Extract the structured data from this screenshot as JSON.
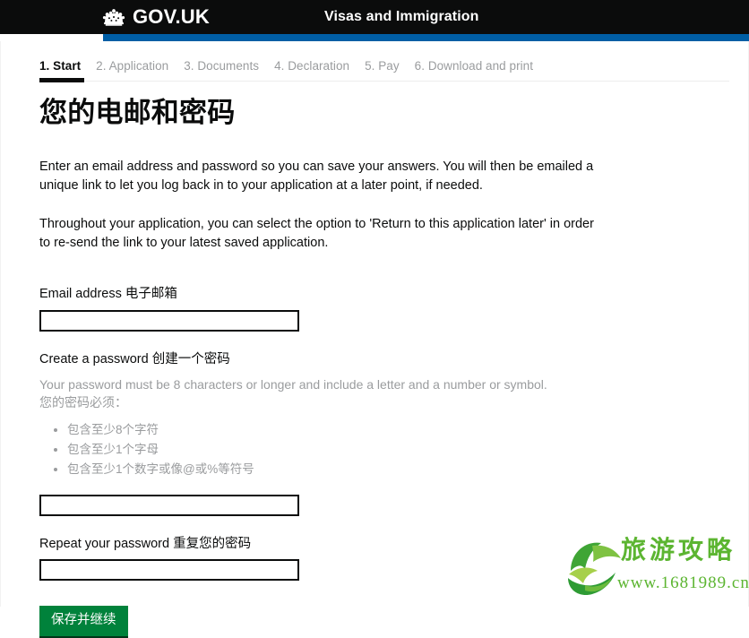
{
  "header": {
    "crown_icon": "crown-icon",
    "wordmark": "GOV.UK",
    "service_name": "Visas and Immigration",
    "bar_color": "#0b0c0c",
    "stripe_color": "#005ea5"
  },
  "step_nav": {
    "items": [
      {
        "label": "1. Start",
        "active": true
      },
      {
        "label": "2. Application",
        "active": false
      },
      {
        "label": "3. Documents",
        "active": false
      },
      {
        "label": "4. Declaration",
        "active": false
      },
      {
        "label": "5. Pay",
        "active": false
      },
      {
        "label": "6. Download and print",
        "active": false
      }
    ]
  },
  "main": {
    "title": "您的电邮和密码",
    "paragraph_1": "Enter an email address and password so you can save your answers. You will then be emailed a unique link to let you log back in to your application at a later point, if needed.",
    "paragraph_2": "Throughout your application, you can select the option to 'Return to this application later' in order to re-send the link to your latest saved application."
  },
  "form": {
    "email": {
      "label": "Email address 电子邮箱",
      "value": "",
      "placeholder": ""
    },
    "password": {
      "label": "Create a password 创建一个密码",
      "hint_en": "Your password must be 8 characters or longer and include a letter and a number or symbol.",
      "hint_cn": "您的密码必须：",
      "requirements": [
        "包含至少8个字符",
        "包含至少1个字母",
        "包含至少1个数字或像@或%等符号"
      ],
      "value": "",
      "placeholder": ""
    },
    "repeat_password": {
      "label": "Repeat your password 重复您的密码",
      "value": "",
      "placeholder": ""
    },
    "submit_label": "保存并继续",
    "submit_color": "#00823b"
  },
  "watermark": {
    "text": "旅游攻略",
    "url": "www.1681989.cn",
    "color": "#5cb531"
  }
}
